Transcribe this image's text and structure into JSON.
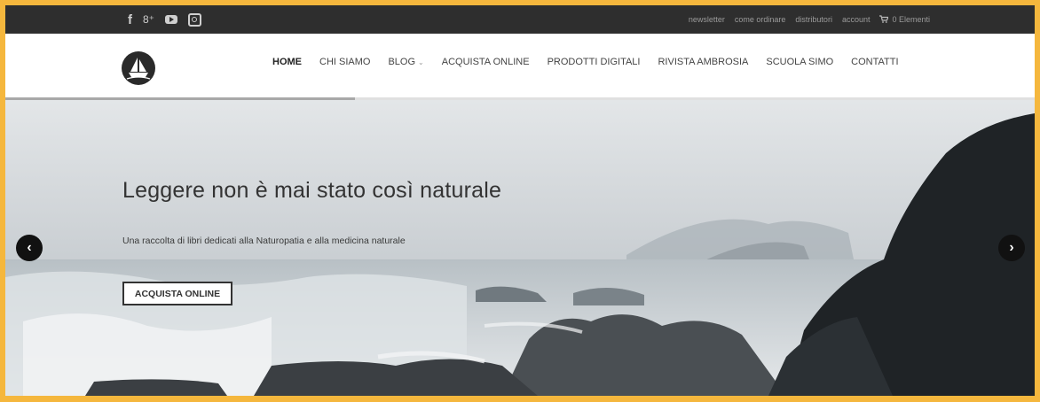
{
  "topbar": {
    "social": [
      {
        "icon": "facebook-icon",
        "glyph": "f"
      },
      {
        "icon": "google-plus-icon",
        "glyph": "8⁺"
      },
      {
        "icon": "youtube-icon",
        "glyph": ""
      },
      {
        "icon": "instagram-icon",
        "glyph": ""
      }
    ],
    "links": [
      "newsletter",
      "come ordinare",
      "distributori",
      "account"
    ],
    "cart_label": "0 Elementi"
  },
  "nav": {
    "items": [
      "HOME",
      "CHI SIAMO",
      "BLOG",
      "ACQUISTA ONLINE",
      "PRODOTTI DIGITALI",
      "RIVISTA AMBROSIA",
      "SCUOLA SIMO",
      "CONTATTI"
    ]
  },
  "hero": {
    "headline": "Leggere non è mai stato così naturale",
    "subtitle": "Una raccolta di libri dedicati alla Naturopatia e alla medicina naturale",
    "cta_label": "ACQUISTA ONLINE",
    "prev_glyph": "‹",
    "next_glyph": "›"
  },
  "slider_progress": 0.34,
  "colors": {
    "frame": "#f5b73d",
    "topbar": "#2e2e2e",
    "text": "#333333"
  }
}
